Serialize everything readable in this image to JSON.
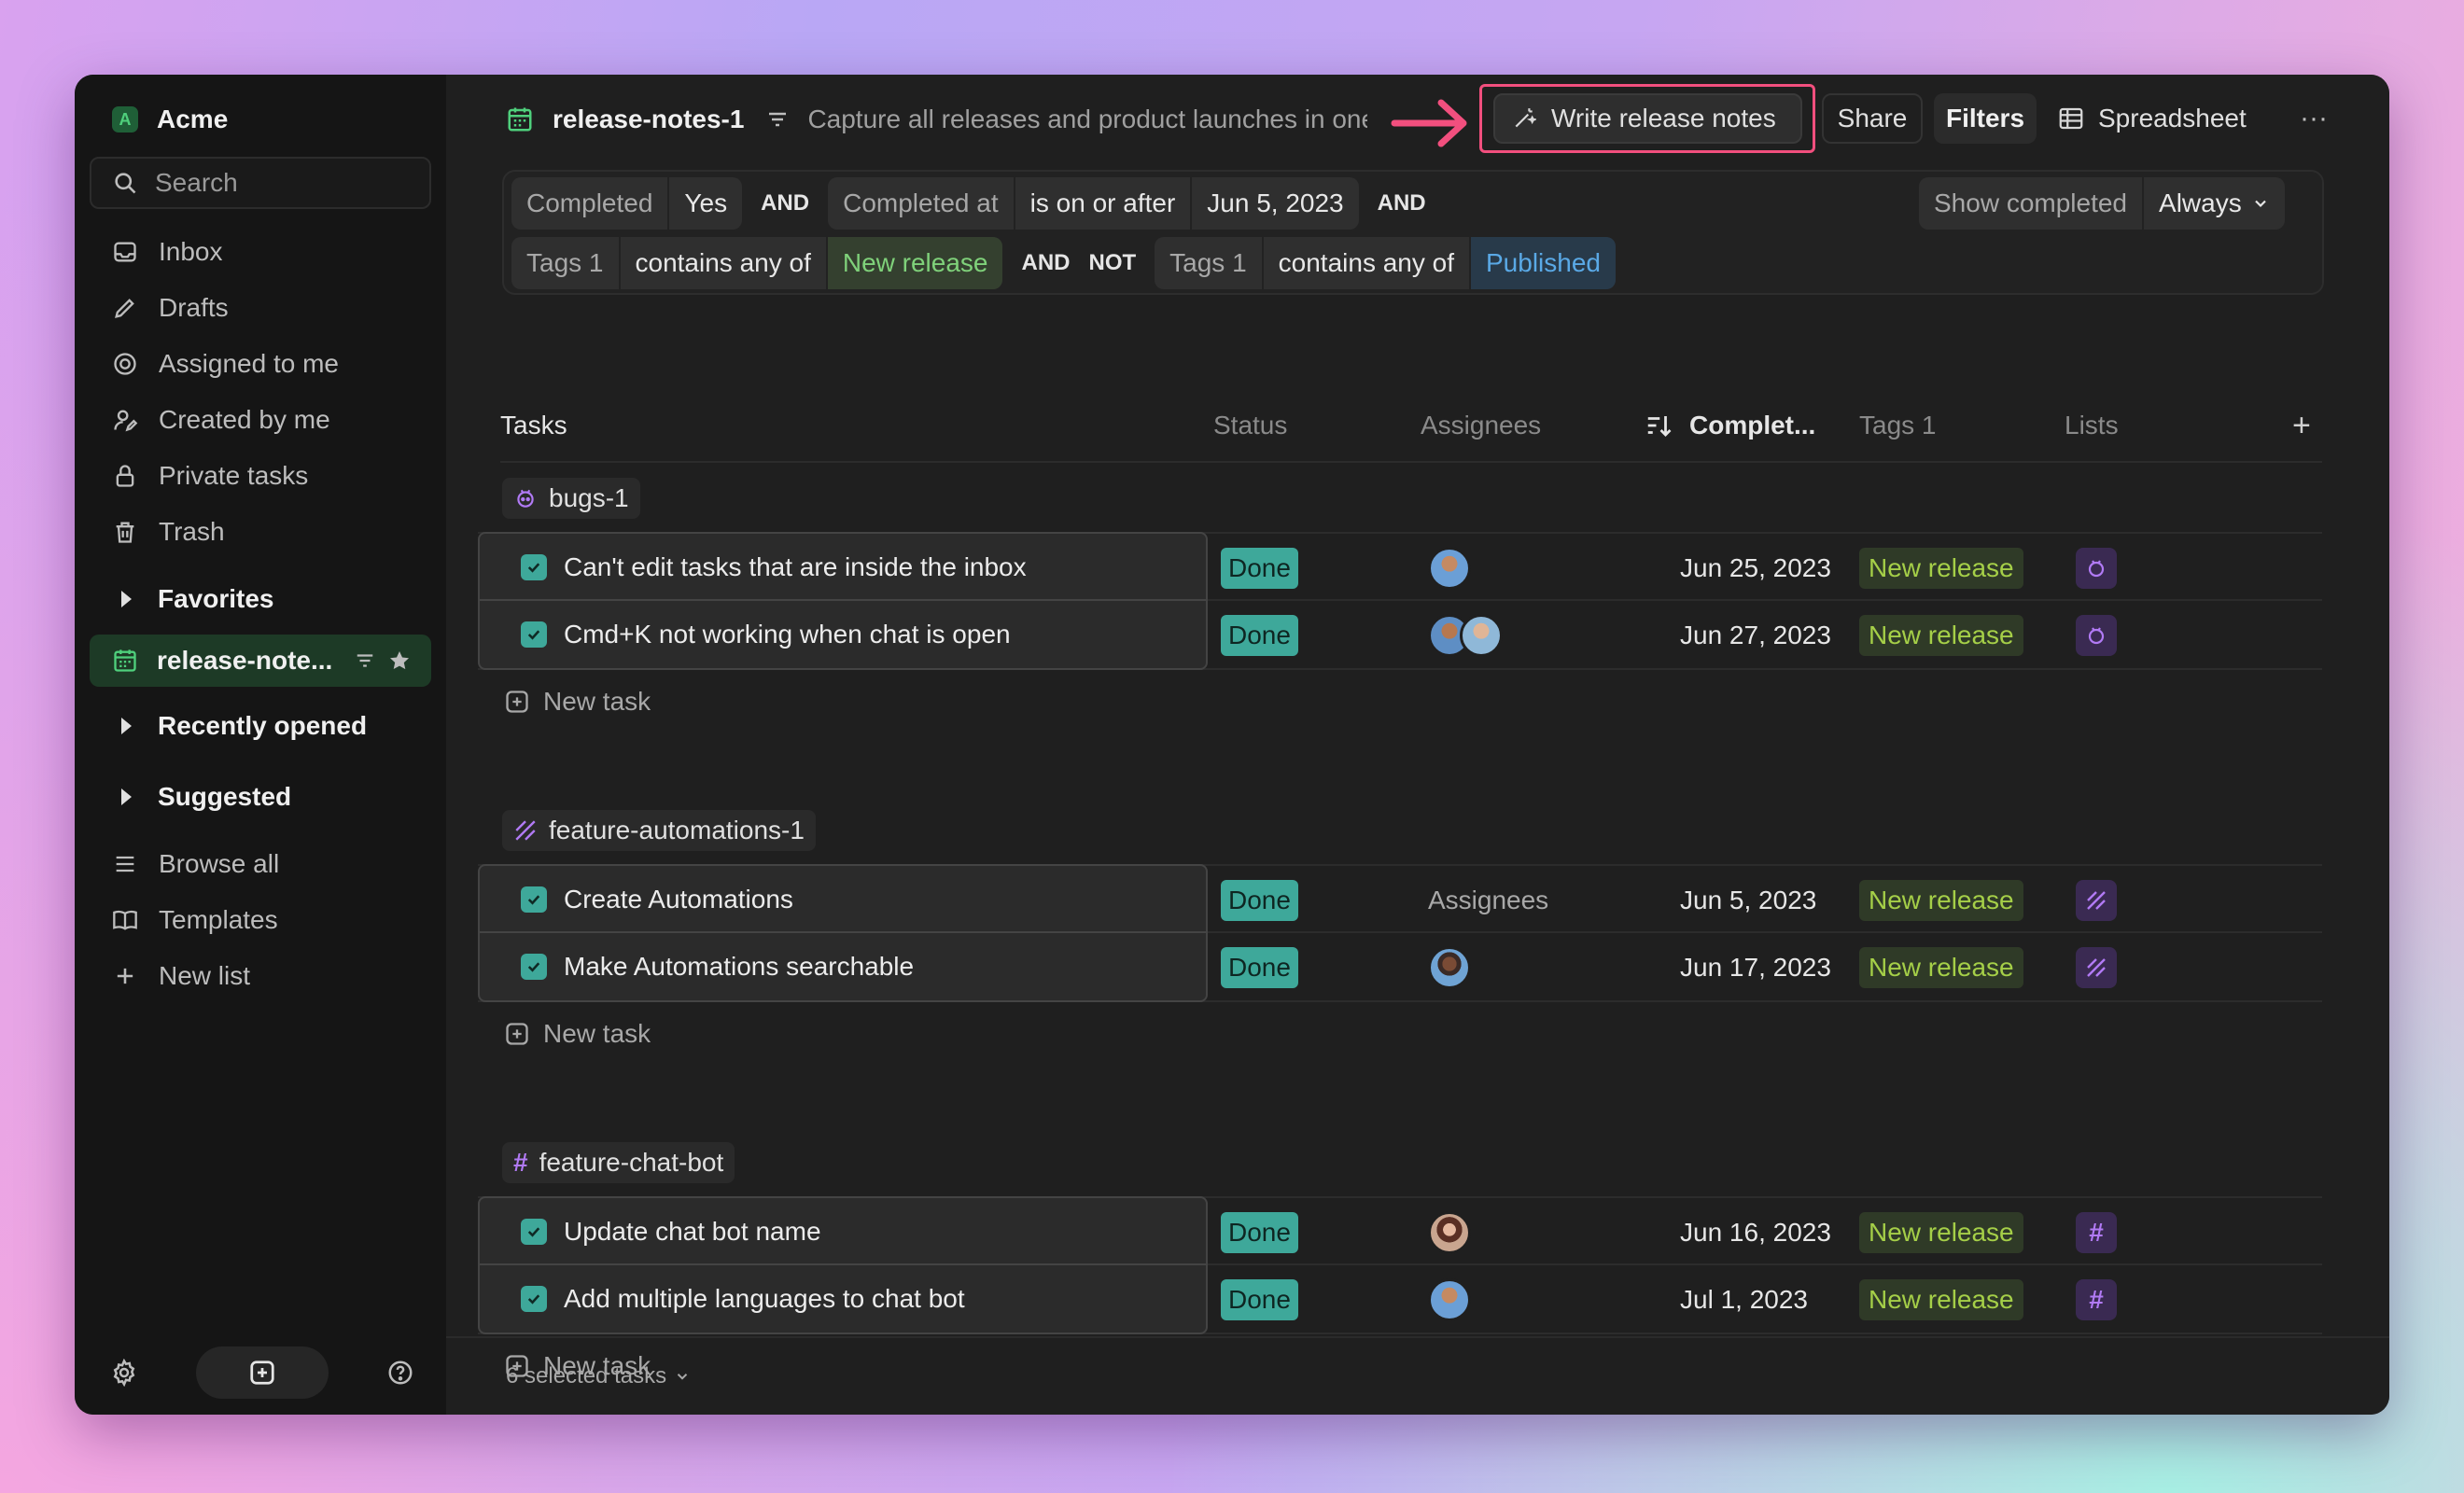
{
  "workspace": {
    "initial": "A",
    "name": "Acme"
  },
  "search": {
    "placeholder": "Search"
  },
  "nav": {
    "inbox": "Inbox",
    "drafts": "Drafts",
    "assigned": "Assigned to me",
    "created": "Created by me",
    "private": "Private tasks",
    "trash": "Trash"
  },
  "sections": {
    "favorites": "Favorites",
    "recent": "Recently opened",
    "suggested": "Suggested"
  },
  "favorite_item": "release-note...",
  "bottom_nav": {
    "browse": "Browse all",
    "templates": "Templates",
    "new_list": "New list"
  },
  "header": {
    "title": "release-notes-1",
    "description": "Capture all releases and product launches in one place",
    "write_button": "Write release notes",
    "share": "Share",
    "filters": "Filters",
    "view": "Spreadsheet",
    "more": "···"
  },
  "filters": {
    "row1": {
      "f1_field": "Completed",
      "f1_value": "Yes",
      "and1": "AND",
      "f2_field": "Completed at",
      "f2_op": "is on or after",
      "f2_value": "Jun 5, 2023",
      "and2": "AND",
      "show_completed": "Show completed",
      "always": "Always"
    },
    "row2": {
      "f3_field": "Tags 1",
      "f3_op": "contains any of",
      "f3_value": "New release",
      "and3": "AND",
      "not": "NOT",
      "f4_field": "Tags 1",
      "f4_op": "contains any of",
      "f4_value": "Published"
    }
  },
  "columns": {
    "tasks": "Tasks",
    "status": "Status",
    "assignees": "Assignees",
    "completed": "Complet...",
    "tags": "Tags 1",
    "lists": "Lists",
    "add": "+"
  },
  "groups": [
    {
      "name": "bugs-1",
      "icon": "bug-icon",
      "tasks": [
        {
          "title": "Can't edit tasks that are inside the inbox",
          "status": "Done",
          "date": "Jun 25, 2023",
          "tag": "New release",
          "list_icon": "bug-icon"
        },
        {
          "title": "Cmd+K not working when chat is open",
          "status": "Done",
          "date": "Jun 27, 2023",
          "tag": "New release",
          "list_icon": "bug-icon"
        }
      ],
      "new_task": "New task"
    },
    {
      "name": "feature-automations-1",
      "icon": "automation-icon",
      "tasks": [
        {
          "title": "Create Automations",
          "status": "Done",
          "assignees_placeholder": "Assignees",
          "date": "Jun 5, 2023",
          "tag": "New release",
          "list_icon": "automation-icon"
        },
        {
          "title": "Make Automations searchable",
          "status": "Done",
          "date": "Jun 17, 2023",
          "tag": "New release",
          "list_icon": "automation-icon"
        }
      ],
      "new_task": "New task"
    },
    {
      "name": "feature-chat-bot",
      "icon": "hash-icon",
      "tasks": [
        {
          "title": "Update chat bot name",
          "status": "Done",
          "date": "Jun 16, 2023",
          "tag": "New release",
          "list_icon": "hash-icon"
        },
        {
          "title": "Add multiple languages to chat bot",
          "status": "Done",
          "date": "Jul 1, 2023",
          "tag": "New release",
          "list_icon": "hash-icon"
        }
      ],
      "new_task": "New task"
    }
  ],
  "footer": {
    "selected": "6 selected tasks"
  },
  "colors": {
    "accent_green": "#3ea89a",
    "tag_green": "#a5cf48",
    "highlight": "#f24f7e",
    "list_purple": "#b17af5"
  }
}
